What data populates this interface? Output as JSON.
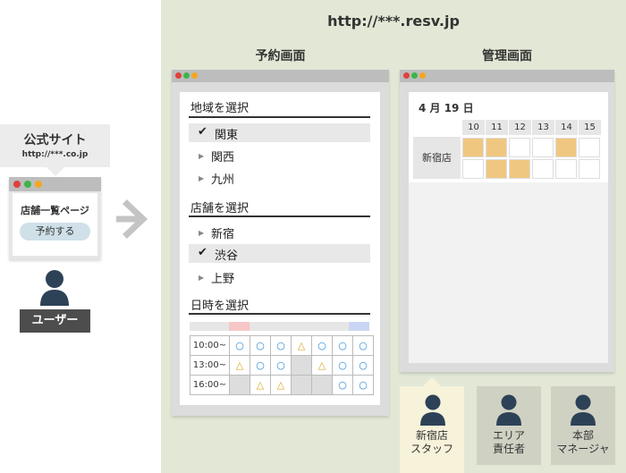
{
  "public_site": {
    "title": "公式サイト",
    "url": "http://***.co.jp",
    "page_title": "店舗一覧ページ",
    "reserve_button": "予約する"
  },
  "user_label": "ユーザー",
  "system": {
    "url": "http://***.resv.jp",
    "reservation_heading": "予約画面",
    "admin_heading": "管理画面"
  },
  "reservation": {
    "region_heading": "地域を選択",
    "regions": [
      "関東",
      "関西",
      "九州"
    ],
    "store_heading": "店舗を選択",
    "stores": [
      "新宿",
      "渋谷",
      "上野"
    ],
    "datetime_heading": "日時を選択",
    "times": [
      "10:00~",
      "13:00~",
      "16:00~"
    ],
    "rows": [
      [
        "○",
        "○",
        "○",
        "△",
        "○",
        "○",
        "○"
      ],
      [
        "△",
        "○",
        "○",
        "",
        "△",
        "○",
        "○"
      ],
      [
        "",
        "△",
        "△",
        "",
        "",
        "○",
        "○"
      ]
    ],
    "gray_cells": [
      [
        1,
        3
      ],
      [
        2,
        0
      ],
      [
        2,
        3
      ],
      [
        2,
        4
      ]
    ],
    "symbols": {
      "circle": "○",
      "triangle": "△"
    }
  },
  "admin": {
    "date": "4 月 19 日",
    "hours": [
      "10",
      "11",
      "12",
      "13",
      "14",
      "15"
    ],
    "store": "新宿店",
    "row1_booked": [
      0,
      1,
      4
    ],
    "row2_booked": [
      1,
      2
    ]
  },
  "staff": [
    {
      "line1": "新宿店",
      "line2": "スタッフ"
    },
    {
      "line1": "エリア",
      "line2": "責任者"
    },
    {
      "line1": "本部",
      "line2": "マネージャ"
    }
  ],
  "colors": {
    "panel_bg": "#e3e8d6",
    "booking": "#f0c780",
    "circle": "#2a8bd6",
    "triangle": "#d9a51c",
    "dot_red": "#e0403a",
    "dot_green": "#3db54a",
    "dot_orange": "#f5a623"
  }
}
